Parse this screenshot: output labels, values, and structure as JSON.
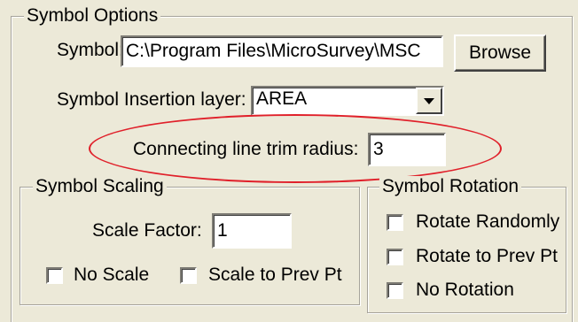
{
  "groups": {
    "symbol_options": "Symbol Options",
    "symbol_scaling": "Symbol Scaling",
    "symbol_rotation": "Symbol Rotation"
  },
  "symbol": {
    "label": "Symbol:",
    "value": "C:\\Program Files\\MicroSurvey\\MSC",
    "browse_label": "Browse"
  },
  "insertion_layer": {
    "label": "Symbol Insertion layer:",
    "selected": "AREA"
  },
  "trim_radius": {
    "label": "Connecting line trim radius:",
    "value": "3"
  },
  "scaling": {
    "scale_factor_label": "Scale Factor:",
    "scale_factor_value": "1",
    "no_scale_label": "No Scale",
    "scale_to_prev_label": "Scale to Prev Pt"
  },
  "rotation": {
    "rotate_randomly_label": "Rotate Randomly",
    "rotate_to_prev_label": "Rotate to Prev Pt",
    "no_rotation_label": "No Rotation"
  },
  "colors": {
    "dialog_bg": "#ece9d8",
    "annotation": "#e0202a"
  }
}
